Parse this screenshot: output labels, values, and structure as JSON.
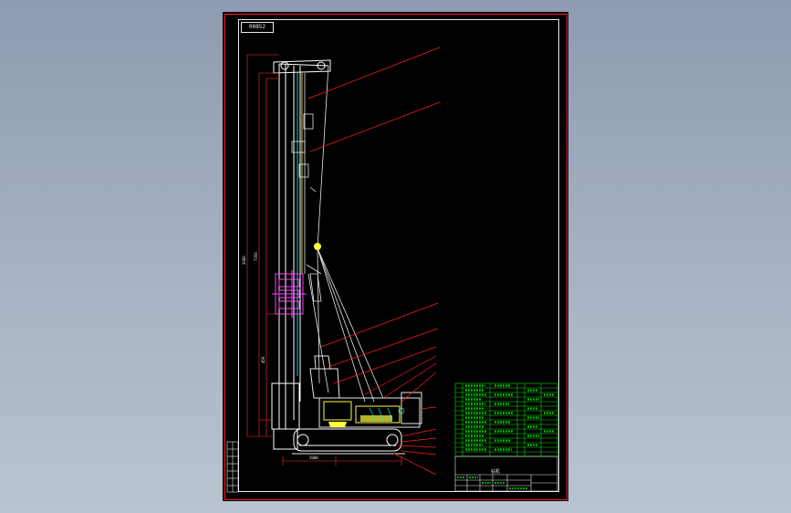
{
  "drawing": {
    "tag_text": "00852",
    "bom_title": "钻机",
    "colors": {
      "sheet": "#000000",
      "frame": "#ff2020",
      "outline": "#e8e8e8",
      "leader": "#ff2020",
      "dimension": "#ff3030",
      "table": "#00e000",
      "mast": "#ffffff",
      "hydraulic": "#ff40ff",
      "cab": "#ffff40",
      "detail": "#00ffff"
    },
    "dimension_labels": [
      "2080",
      "7350",
      "450",
      "2000"
    ]
  }
}
